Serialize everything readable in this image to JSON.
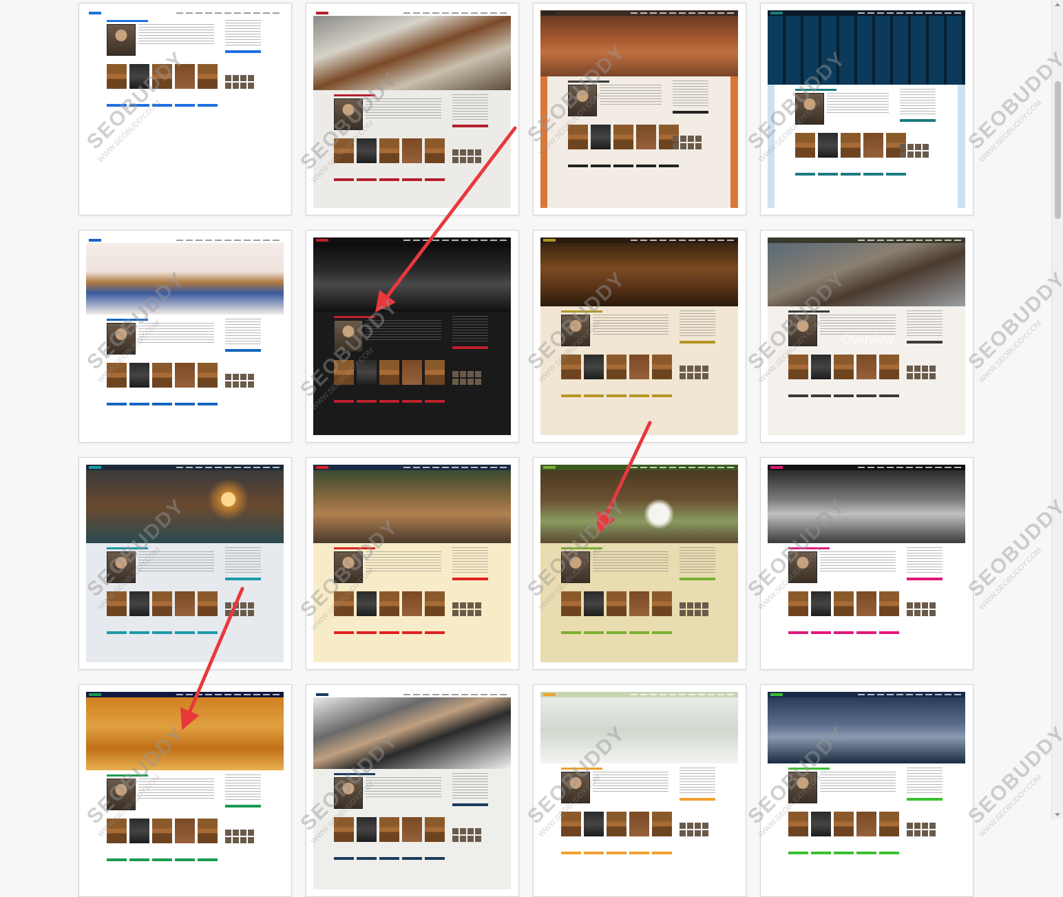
{
  "watermark": {
    "brand": "SEOBUDDY",
    "url": "WWW.SEOBUDDY.COM"
  },
  "cards": [
    {
      "id": "theme-1",
      "hero": "none",
      "nav_bg": "#ffffff",
      "accent": "#1e6fe0",
      "body_bg": "#ffffff"
    },
    {
      "id": "theme-2",
      "hero": "leather-tools",
      "nav_bg": "#ffffff",
      "accent": "#b3202c",
      "body_bg": "#ecebe7"
    },
    {
      "id": "theme-3",
      "hero": "antique-room",
      "nav_bg": "#3a2a20",
      "accent": "#222222",
      "body_bg": "#f2ece4",
      "frame": "#d9773a"
    },
    {
      "id": "theme-4",
      "hero": "stained-glass",
      "nav_bg": "#0c1a2a",
      "accent": "#1a7a80",
      "body_bg": "#ffffff",
      "frame": "#cfe0ee"
    },
    {
      "id": "theme-5",
      "hero": "thread-spools",
      "nav_bg": "#ffffff",
      "accent": "#1565c0",
      "body_bg": "#ffffff"
    },
    {
      "id": "theme-6",
      "hero": "dark-shop",
      "nav_bg": "#111111",
      "accent": "#c0202c",
      "body_bg": "#1a1a1a"
    },
    {
      "id": "theme-7",
      "hero": "carved-wood",
      "nav_bg": "#2a1a10",
      "accent": "#b59625",
      "body_bg": "#f1e6d3"
    },
    {
      "id": "theme-8",
      "hero": "wood-workshop",
      "nav_bg": "#3a3a2a",
      "accent": "#3a3a3a",
      "body_bg": "#f4f1ec",
      "overlay": "Overview"
    },
    {
      "id": "theme-9",
      "hero": "lamp",
      "nav_bg": "#1c2a38",
      "accent": "#1a9aa8",
      "body_bg": "#e6e9ee"
    },
    {
      "id": "theme-10",
      "hero": "cafe",
      "nav_bg": "#1a2a44",
      "accent": "#e02020",
      "body_bg": "#f8ecc8"
    },
    {
      "id": "theme-11",
      "hero": "garden",
      "nav_bg": "#3a5a20",
      "accent": "#7ab030",
      "body_bg": "#e8dcb0"
    },
    {
      "id": "theme-12",
      "hero": "bw-store",
      "nav_bg": "#111111",
      "accent": "#e0187a",
      "body_bg": "#ffffff"
    },
    {
      "id": "theme-13",
      "hero": "craft-table",
      "nav_bg": "#101840",
      "accent": "#1a9a50",
      "body_bg": "#ffffff"
    },
    {
      "id": "theme-14",
      "hero": "pliers",
      "nav_bg": "#ffffff",
      "accent": "#1a3a5a",
      "body_bg": "#eeeeea"
    },
    {
      "id": "theme-15",
      "hero": "plants-shelf",
      "nav_bg": "#c8d4b0",
      "accent": "#f0a030",
      "body_bg": "#ffffff"
    },
    {
      "id": "theme-16",
      "hero": "blue-workshop",
      "nav_bg": "#1a2a4a",
      "accent": "#3ac030",
      "body_bg": "#ffffff"
    }
  ],
  "arrows": {
    "color": "#e8383c"
  }
}
